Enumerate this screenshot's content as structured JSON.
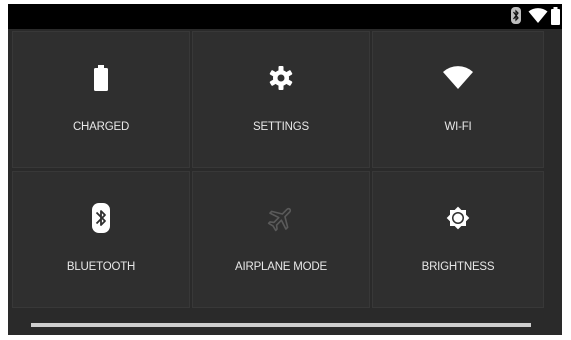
{
  "status_bar": {
    "icons": [
      "bluetooth-icon",
      "wifi-icon",
      "battery-icon"
    ]
  },
  "quick_settings": {
    "tiles": [
      {
        "label": "CHARGED",
        "icon": "battery-icon"
      },
      {
        "label": "SETTINGS",
        "icon": "gear-icon"
      },
      {
        "label": "WI-FI",
        "icon": "wifi-icon"
      },
      {
        "label": "BLUETOOTH",
        "icon": "bluetooth-icon"
      },
      {
        "label": "AIRPLANE MODE",
        "icon": "airplane-icon",
        "state": "disabled"
      },
      {
        "label": "BRIGHTNESS",
        "icon": "brightness-icon"
      }
    ]
  },
  "colors": {
    "tile_background": "#2f2f2f",
    "text": "#e8e8e8",
    "icon_active": "#ffffff",
    "icon_disabled": "#5a5a5a",
    "status_bar": "#000000"
  }
}
